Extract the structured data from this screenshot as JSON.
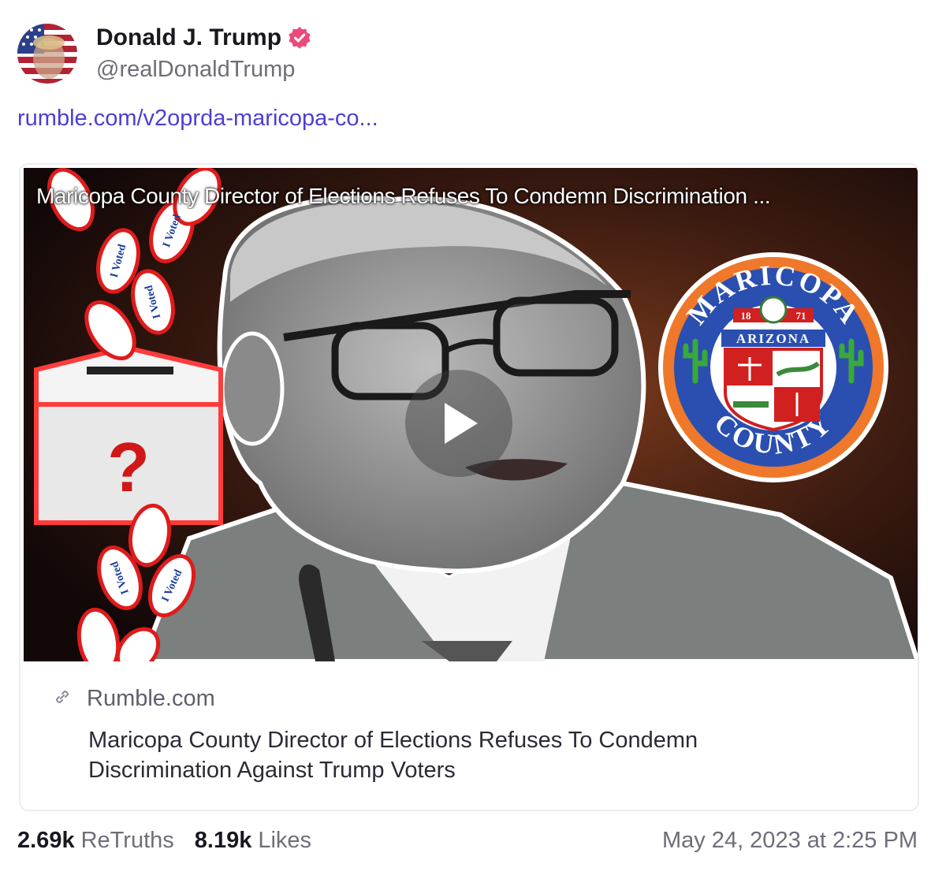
{
  "author": {
    "display_name": "Donald J. Trump",
    "handle": "@realDonaldTrump",
    "verified_color": "#ea4b7a"
  },
  "post": {
    "link_text": "rumble.com/v2oprda-maricopa-co..."
  },
  "link_card": {
    "video_title": "Maricopa County Director of Elections Refuses To Condemn Discrimination ...",
    "seal": {
      "top_text": "MARICOPA",
      "year_left": "18",
      "year_right": "71",
      "band_text": "ARIZONA",
      "bottom_text": "COUNTY"
    },
    "sticker_text": "I Voted",
    "box_mark": "?",
    "source_domain": "Rumble.com",
    "title": "Maricopa County Director of Elections Refuses To Condemn Discrimination Against Trump Voters"
  },
  "stats": {
    "retruths_count": "2.69k",
    "retruths_label": "ReTruths",
    "likes_count": "8.19k",
    "likes_label": "Likes",
    "timestamp": "May 24, 2023 at 2:25 PM"
  },
  "colors": {
    "link": "#4b3fd4",
    "seal_blue": "#2a4fb0",
    "seal_orange": "#f0782a"
  }
}
